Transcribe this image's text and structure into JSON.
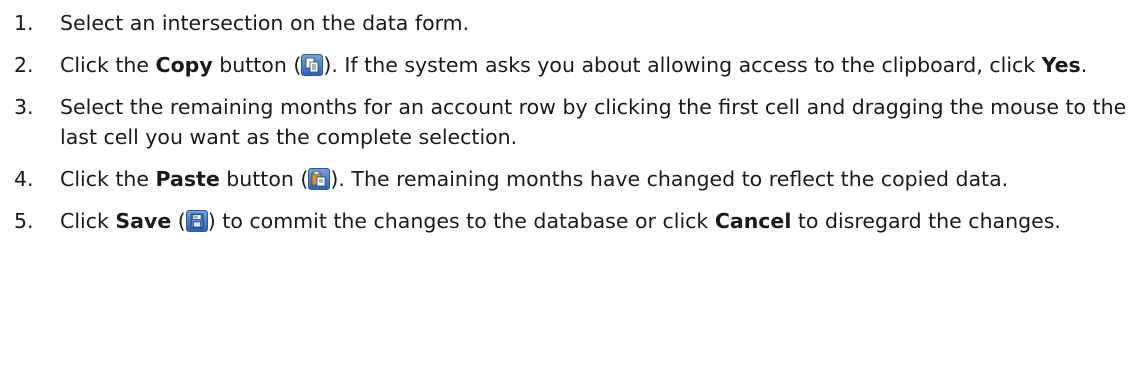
{
  "steps": [
    {
      "num": "1.",
      "text_a": "Select an intersection on the data form."
    },
    {
      "num": "2.",
      "text_a": "Click the ",
      "bold_a": "Copy",
      "text_b": " button (",
      "icon": "copy-icon",
      "text_c": "). If the system asks you about allowing access to the clipboard, click ",
      "bold_b": "Yes",
      "text_d": "."
    },
    {
      "num": "3.",
      "text_a": "Select the remaining months for an account row by clicking the first cell and dragging the mouse to the last cell you want as the complete selection."
    },
    {
      "num": "4.",
      "text_a": "Click the ",
      "bold_a": "Paste",
      "text_b": " button (",
      "icon": "paste-icon",
      "text_c": "). The remaining months have changed to reflect the copied data."
    },
    {
      "num": "5.",
      "text_a": "Click ",
      "bold_a": "Save",
      "text_b": " (",
      "icon": "save-icon",
      "text_c": ") to commit the changes to the database or click ",
      "bold_b": "Cancel",
      "text_d": " to disregard the changes."
    }
  ],
  "colors": {
    "text": "#1a1a1a",
    "icon_blue": "#3f7ad0"
  }
}
